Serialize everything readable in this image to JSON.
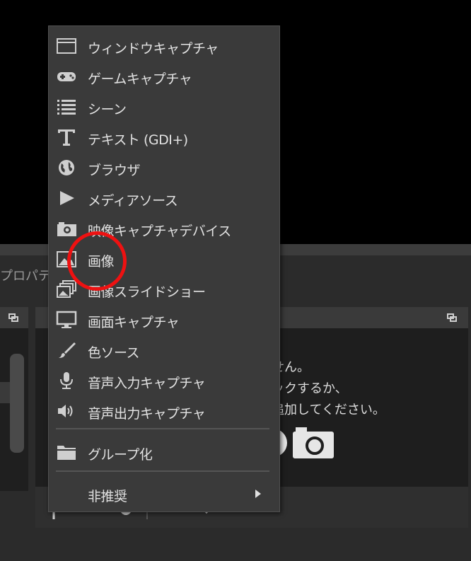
{
  "props_tab": {
    "label": "プロパテ"
  },
  "sources_panel": {
    "empty_lines": [
      "せん。",
      "ックするか、",
      "追加してください。"
    ]
  },
  "context_menu": {
    "items": [
      {
        "label": "ウィンドウキャプチャ",
        "icon": "window-icon"
      },
      {
        "label": "ゲームキャプチャ",
        "icon": "gamepad-icon"
      },
      {
        "label": "シーン",
        "icon": "list-icon"
      },
      {
        "label": "テキスト (GDI+)",
        "icon": "text-icon"
      },
      {
        "label": "ブラウザ",
        "icon": "globe-icon"
      },
      {
        "label": "メディアソース",
        "icon": "play-icon"
      },
      {
        "label": "映像キャプチャデバイス",
        "icon": "camera-icon"
      },
      {
        "label": "画像",
        "icon": "image-icon"
      },
      {
        "label": "画像スライドショー",
        "icon": "slideshow-icon"
      },
      {
        "label": "画面キャプチャ",
        "icon": "monitor-icon"
      },
      {
        "label": "色ソース",
        "icon": "brush-icon"
      },
      {
        "label": "音声入力キャプチャ",
        "icon": "microphone-icon"
      },
      {
        "label": "音声出力キャプチャ",
        "icon": "speaker-icon"
      },
      {
        "label": "グループ化",
        "icon": "folder-icon"
      },
      {
        "label": "非推奨",
        "icon": ""
      }
    ]
  },
  "colors": {
    "highlight": "#ee1111",
    "menu_bg": "#3a3a3a"
  }
}
